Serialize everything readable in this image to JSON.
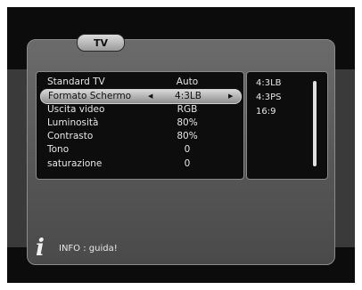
{
  "menu": {
    "title": "TV",
    "rows": [
      {
        "label": "Standard TV",
        "value": "Auto"
      },
      {
        "label": "Formato Schermo",
        "value": "4:3LB"
      },
      {
        "label": "Uscita video",
        "value": "RGB"
      },
      {
        "label": "Luminosità",
        "value": "80%"
      },
      {
        "label": "Contrasto",
        "value": "80%"
      },
      {
        "label": "Tono",
        "value": "0"
      },
      {
        "label": "saturazione",
        "value": "0"
      }
    ],
    "selected_index": 1
  },
  "options": [
    "4:3LB",
    "4:3PS",
    "16:9"
  ],
  "footer": {
    "icon": "info-icon",
    "text": "INFO : guida!"
  }
}
